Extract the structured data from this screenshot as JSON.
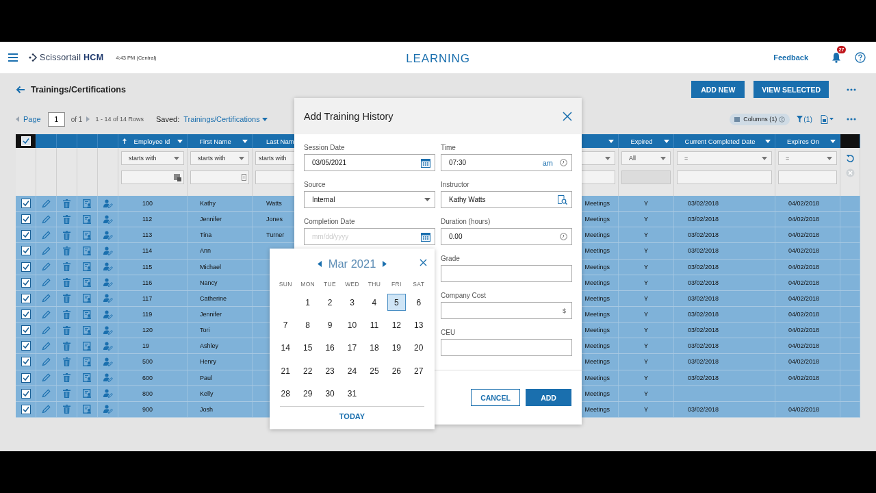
{
  "header": {
    "app_name": "Scissortail",
    "app_suffix": "HCM",
    "time": "4:43 PM (Central)",
    "section": "LEARNING",
    "feedback": "Feedback",
    "notifications": "27"
  },
  "page": {
    "title": "Trainings/Certifications",
    "actions": [
      "ADD NEW",
      "VIEW SELECTED"
    ]
  },
  "pager": {
    "page_label": "Page",
    "page": "1",
    "of": "of 1",
    "rows": "1 - 14 of 14 Rows",
    "saved_label": "Saved:",
    "saved_view": "Trainings/Certifications",
    "columns_chip": "Columns (1)",
    "filter_count": "(1)"
  },
  "table": {
    "select_all_checked": true,
    "columns": [
      {
        "kind": "id",
        "label": "Employee Id",
        "sorted": true,
        "filter_op": "starts with"
      },
      {
        "kind": "first",
        "label": "First Name",
        "sorted": false,
        "filter_op": "starts with"
      },
      {
        "kind": "last",
        "label": "Last Nam",
        "sorted": false,
        "filter_op": "starts with"
      },
      {
        "kind": "program"
      },
      {
        "kind": "expired",
        "label": "Expired",
        "sorted": false,
        "filter_op": "All"
      },
      {
        "kind": "completed",
        "label": "Current Completed Date",
        "sorted": false,
        "filter_op": "="
      },
      {
        "kind": "expires",
        "label": "Expires On",
        "sorted": false,
        "filter_op": "="
      }
    ],
    "rows": [
      {
        "checked": true,
        "id": "100",
        "first": "Kathy",
        "last": "Watts",
        "program": "Meetings",
        "expired": "Y",
        "completed": "03/02/2018",
        "expires": "04/02/2018"
      },
      {
        "checked": true,
        "id": "112",
        "first": "Jennifer",
        "last": "Jones",
        "program": "Meetings",
        "expired": "Y",
        "completed": "03/02/2018",
        "expires": "04/02/2018"
      },
      {
        "checked": true,
        "id": "113",
        "first": "Tina",
        "last": "Turner",
        "program": "Meetings",
        "expired": "Y",
        "completed": "03/02/2018",
        "expires": "04/02/2018"
      },
      {
        "checked": true,
        "id": "114",
        "first": "Ann",
        "program": "Meetings",
        "expired": "Y",
        "completed": "03/02/2018",
        "expires": "04/02/2018"
      },
      {
        "checked": true,
        "id": "115",
        "first": "Michael",
        "program": "Meetings",
        "expired": "Y",
        "completed": "03/02/2018",
        "expires": "04/02/2018"
      },
      {
        "checked": true,
        "id": "116",
        "first": "Nancy",
        "program": "Meetings",
        "expired": "Y",
        "completed": "03/02/2018",
        "expires": "04/02/2018"
      },
      {
        "checked": true,
        "id": "117",
        "first": "Catherine",
        "program": "Meetings",
        "expired": "Y",
        "completed": "03/02/2018",
        "expires": "04/02/2018"
      },
      {
        "checked": true,
        "id": "119",
        "first": "Jennifer",
        "program": "Meetings",
        "expired": "Y",
        "completed": "03/02/2018",
        "expires": "04/02/2018"
      },
      {
        "checked": true,
        "id": "120",
        "first": "Tori",
        "program": "Meetings",
        "expired": "Y",
        "completed": "03/02/2018",
        "expires": "04/02/2018"
      },
      {
        "checked": true,
        "id": "19",
        "first": "Ashley",
        "program": "Meetings",
        "expired": "Y",
        "completed": "03/02/2018",
        "expires": "04/02/2018"
      },
      {
        "checked": true,
        "id": "500",
        "first": "Henry",
        "program": "Meetings",
        "expired": "Y",
        "completed": "03/02/2018",
        "expires": "04/02/2018"
      },
      {
        "checked": true,
        "id": "600",
        "first": "Paul",
        "program": "Meetings",
        "expired": "Y",
        "completed": "03/02/2018",
        "expires": "04/02/2018"
      },
      {
        "checked": true,
        "id": "800",
        "first": "Kelly",
        "program": "Meetings",
        "expired": "Y"
      },
      {
        "checked": true,
        "id": "900",
        "first": "Josh",
        "program": "Meetings",
        "expired": "Y",
        "completed": "03/02/2018",
        "expires": "04/02/2018"
      }
    ]
  },
  "modal": {
    "title": "Add Training History",
    "left_fields": [
      {
        "kind": "date",
        "label": "Session Date",
        "value": "03/05/2021"
      },
      {
        "kind": "select",
        "label": "Source",
        "value": "Internal"
      },
      {
        "kind": "date",
        "label": "Completion Date",
        "placeholder": "mm/dd/yyyy"
      }
    ],
    "right_fields": [
      {
        "kind": "time",
        "label": "Time",
        "value": "07:30",
        "suffix": "am"
      },
      {
        "kind": "lookup",
        "label": "Instructor",
        "value": "Kathy Watts"
      },
      {
        "kind": "duration",
        "label": "Duration (hours)",
        "value": "0.00"
      },
      {
        "kind": "text",
        "label": "Grade"
      },
      {
        "kind": "currency",
        "label": "Company Cost",
        "suffix": "$"
      },
      {
        "kind": "text",
        "label": "CEU"
      }
    ],
    "buttons": [
      {
        "kind": "secondary",
        "label": "CANCEL"
      },
      {
        "kind": "primary",
        "label": "ADD"
      }
    ]
  },
  "calendar": {
    "month": "Mar 2021",
    "weekdays": [
      "SUN",
      "MON",
      "TUE",
      "WED",
      "THU",
      "FRI",
      "SAT"
    ],
    "days": [
      {
        "kind": "blank"
      },
      {
        "kind": "day",
        "day": "1",
        "selected": false
      },
      {
        "kind": "day",
        "day": "2",
        "selected": false
      },
      {
        "kind": "day",
        "day": "3",
        "selected": false
      },
      {
        "kind": "day",
        "day": "4",
        "selected": false
      },
      {
        "kind": "day",
        "day": "5",
        "selected": true
      },
      {
        "kind": "day",
        "day": "6",
        "selected": false
      },
      {
        "kind": "day",
        "day": "7",
        "selected": false
      },
      {
        "kind": "day",
        "day": "8",
        "selected": false
      },
      {
        "kind": "day",
        "day": "9",
        "selected": false
      },
      {
        "kind": "day",
        "day": "10",
        "selected": false
      },
      {
        "kind": "day",
        "day": "11",
        "selected": false
      },
      {
        "kind": "day",
        "day": "12",
        "selected": false
      },
      {
        "kind": "day",
        "day": "13",
        "selected": false
      },
      {
        "kind": "day",
        "day": "14",
        "selected": false
      },
      {
        "kind": "day",
        "day": "15",
        "selected": false
      },
      {
        "kind": "day",
        "day": "16",
        "selected": false
      },
      {
        "kind": "day",
        "day": "17",
        "selected": false
      },
      {
        "kind": "day",
        "day": "18",
        "selected": false
      },
      {
        "kind": "day",
        "day": "19",
        "selected": false
      },
      {
        "kind": "day",
        "day": "20",
        "selected": false
      },
      {
        "kind": "day",
        "day": "21",
        "selected": false
      },
      {
        "kind": "day",
        "day": "22",
        "selected": false
      },
      {
        "kind": "day",
        "day": "23",
        "selected": false
      },
      {
        "kind": "day",
        "day": "24",
        "selected": false
      },
      {
        "kind": "day",
        "day": "25",
        "selected": false
      },
      {
        "kind": "day",
        "day": "26",
        "selected": false
      },
      {
        "kind": "day",
        "day": "27",
        "selected": false
      },
      {
        "kind": "day",
        "day": "28",
        "selected": false
      },
      {
        "kind": "day",
        "day": "29",
        "selected": false
      },
      {
        "kind": "day",
        "day": "30",
        "selected": false
      },
      {
        "kind": "day",
        "day": "31",
        "selected": false
      }
    ],
    "today": "TODAY"
  }
}
